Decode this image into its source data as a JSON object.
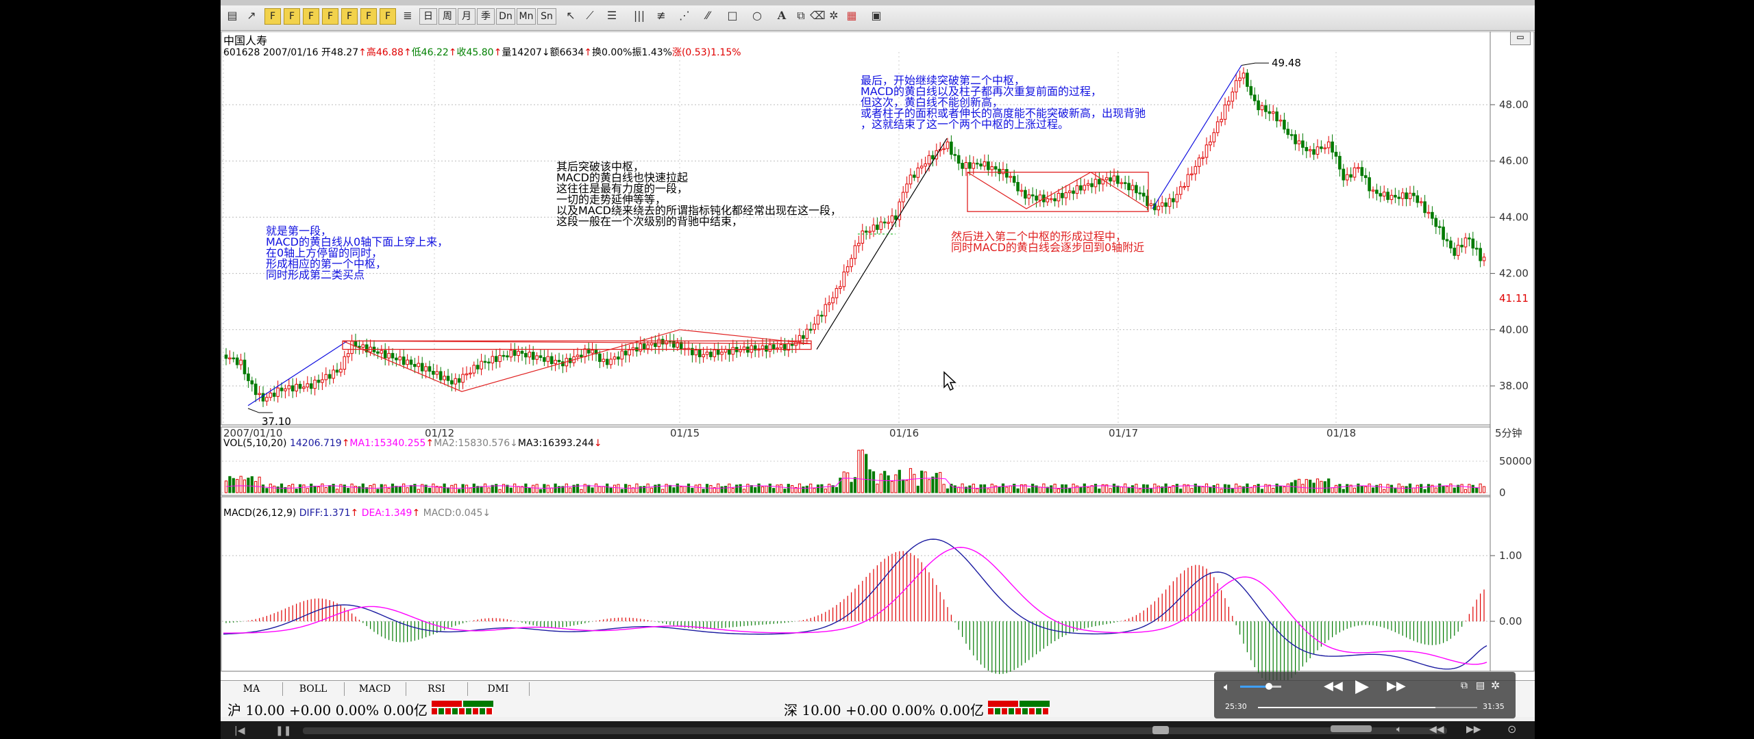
{
  "toolbar": {
    "period_buttons": [
      "日",
      "周",
      "月",
      "季",
      "Dn",
      "Mn",
      "Sn"
    ]
  },
  "header": {
    "stock_name": "中国人寿",
    "info_line": [
      {
        "text": "601628 2007/01/16 开48.27",
        "color": "#000000"
      },
      {
        "text": "↑",
        "color": "#e00000"
      },
      {
        "text": "高46.88",
        "color": "#e00000"
      },
      {
        "text": "↑",
        "color": "#e00000"
      },
      {
        "text": "低46.22",
        "color": "#008000"
      },
      {
        "text": "↑",
        "color": "#e00000"
      },
      {
        "text": "收45.80",
        "color": "#008000"
      },
      {
        "text": "↑",
        "color": "#e00000"
      },
      {
        "text": "量14207",
        "color": "#000000"
      },
      {
        "text": "↓",
        "color": "#000000"
      },
      {
        "text": "额6634",
        "color": "#000000"
      },
      {
        "text": "↑",
        "color": "#e00000"
      },
      {
        "text": "换0.00%",
        "color": "#000000"
      },
      {
        "text": "振1.43%",
        "color": "#000000"
      },
      {
        "text": "涨(0.53)1.15%",
        "color": "#e00000"
      }
    ]
  },
  "price_panel": {
    "y_ticks": [
      "48.00",
      "46.00",
      "44.00",
      "42.00",
      "40.00",
      "38.00"
    ],
    "current_price": "41.11",
    "high_label": "49.48",
    "low_label": "37.10",
    "period_label": "5分钟",
    "x_ticks": [
      "2007/01/10",
      "01/12",
      "01/15",
      "01/16",
      "01/17",
      "01/18"
    ]
  },
  "annotations": {
    "first_segment": "就是第一段，\nMACD的黄白线从0轴下面上穿上来，\n在0轴上方停留的同时，\n形成相应的第一个中枢，\n同时形成第二类买点",
    "breakout": "其后突破该中枢，\nMACD的黄白线也快速拉起\n这往往是最有力度的一段，\n一切的走势延伸等等，\n以及MACD绕来绕去的所谓指标钝化都经常出现在这一段，\n这段一般在一个次级别的背驰中结束，",
    "second_pivot": "然后进入第二个中枢的形成过程中，\n同时MACD的黄白线会逐步回到0轴附近",
    "final": "最后，开始继续突破第二个中枢，\nMACD的黄白线以及柱子都再次重复前面的过程，\n但这次，黄白线不能创新高，\n或者柱子的面积或者伸长的高度能不能突破新高，出现背驰\n，这就结束了这一个两个中枢的上涨过程。"
  },
  "volume_panel": {
    "legend": [
      {
        "text": "VOL(5,10,20)",
        "color": "#000000"
      },
      {
        "text": " 14206.719",
        "color": "#1a1aa0"
      },
      {
        "text": "↑",
        "color": "#e00000"
      },
      {
        "text": "MA1:15340.255",
        "color": "#ff00ff"
      },
      {
        "text": "↑",
        "color": "#e00000"
      },
      {
        "text": "MA2:15830.576",
        "color": "#808080"
      },
      {
        "text": "↓",
        "color": "#808080"
      },
      {
        "text": "MA3:16393.244",
        "color": "#000000"
      },
      {
        "text": "↓",
        "color": "#e00000"
      }
    ],
    "y_ticks": [
      "50000",
      "0"
    ]
  },
  "macd_panel": {
    "legend": [
      {
        "text": "MACD(26,12,9)",
        "color": "#000000"
      },
      {
        "text": " DIFF:1.371",
        "color": "#1a1aa0"
      },
      {
        "text": "↑",
        "color": "#e00000"
      },
      {
        "text": " DEA:1.349",
        "color": "#ff00ff"
      },
      {
        "text": "↑",
        "color": "#e00000"
      },
      {
        "text": " MACD:0.045",
        "color": "#808080"
      },
      {
        "text": "↓",
        "color": "#808080"
      }
    ],
    "y_ticks": [
      "1.00",
      "0.00"
    ]
  },
  "bottom_tabs": [
    "MA",
    "BOLL",
    "MACD",
    "RSI",
    "DMI"
  ],
  "status_bar": {
    "sh": "沪 10.00 +0.00 0.00% 0.00亿",
    "sz": "深 10.00 +0.00 0.00% 0.00亿"
  },
  "player": {
    "elapsed": "25:30",
    "total": "31:35",
    "progress": 0.81,
    "volume": 0.7
  },
  "colors": {
    "up": "#e00000",
    "down": "#007a00",
    "annotation_blue": "#1010e0",
    "annotation_red": "#e02020",
    "diff": "#1a1aa0",
    "dea": "#ff00ff"
  }
}
